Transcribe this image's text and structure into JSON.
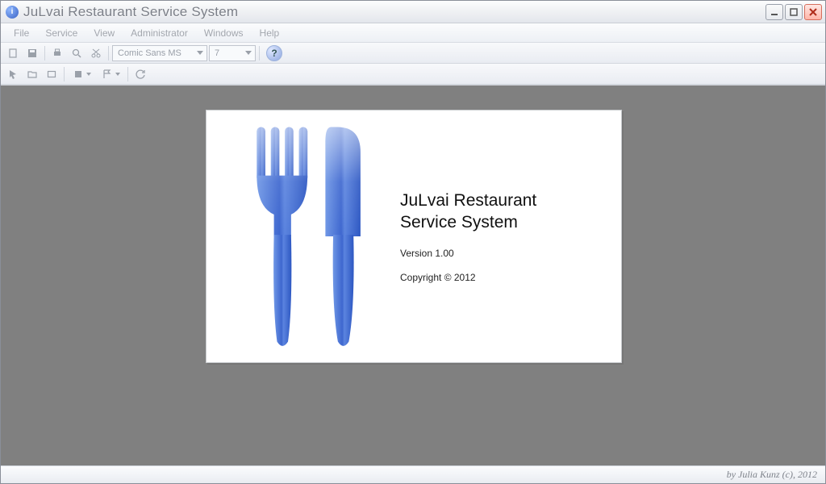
{
  "window": {
    "title": "JuLvai Restaurant Service System"
  },
  "menubar": {
    "items": [
      "File",
      "Service",
      "View",
      "Administrator",
      "Windows",
      "Help"
    ]
  },
  "toolbar1": {
    "font_name": "Comic Sans MS",
    "font_size": "7"
  },
  "splash": {
    "title_line1": "JuLvai Restaurant",
    "title_line2": "Service System",
    "version": "Version 1.00",
    "copyright": "Copyright ©  2012"
  },
  "statusbar": {
    "credits": "by Julia Kunz (c), 2012"
  }
}
